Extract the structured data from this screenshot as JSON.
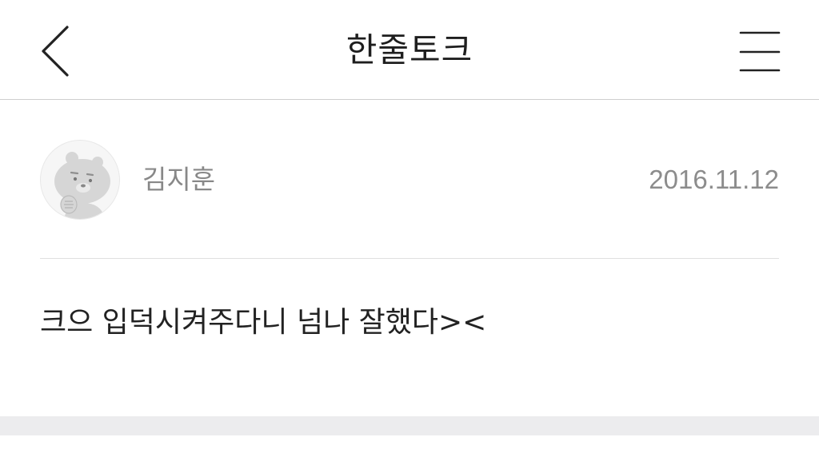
{
  "header": {
    "title": "한줄토크",
    "back_icon": "chevron-left-icon",
    "menu_icon": "hamburger-menu-icon"
  },
  "post": {
    "avatar_icon": "bear-character-avatar",
    "author": "김지훈",
    "date": "2016.11.12",
    "comment": "크으 입덕시켜주다니 넘나 잘했다><"
  },
  "colors": {
    "title": "#1e1e1e",
    "meta_text": "#888888",
    "comment_text": "#222222",
    "divider": "#e0e0e0",
    "footer_band": "#ececee"
  }
}
